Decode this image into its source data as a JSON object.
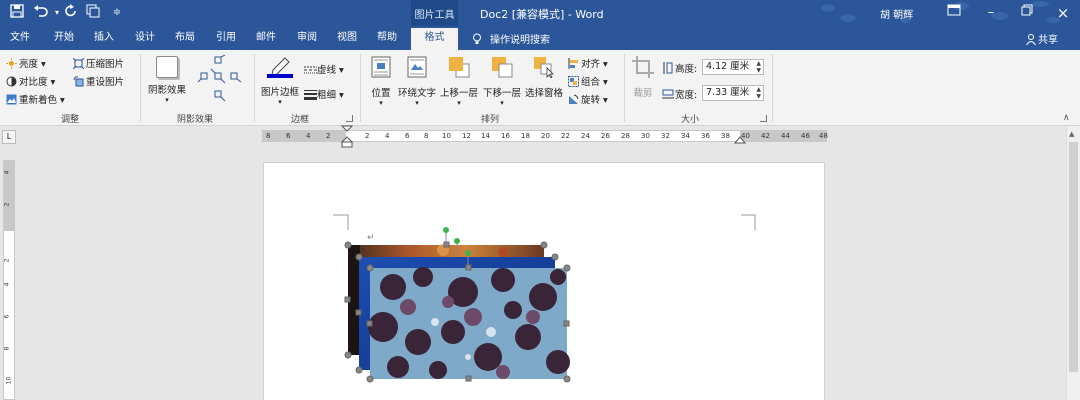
{
  "titlebar": {
    "context_tool": "图片工具",
    "doc_title": "Doc2 [兼容模式]  -  Word",
    "user": "胡 朝辉",
    "icons": [
      "save-icon",
      "undo-icon",
      "redo-icon",
      "touch-mode-icon",
      "customize-icon",
      "ribbon-display-icon",
      "minimize-icon",
      "restore-icon",
      "close-icon"
    ]
  },
  "tabs": [
    "文件",
    "开始",
    "插入",
    "设计",
    "布局",
    "引用",
    "邮件",
    "审阅",
    "视图",
    "帮助",
    "格式"
  ],
  "active_tab": "格式",
  "tell_me": "操作说明搜索",
  "share": "共享",
  "groups": {
    "adjust": {
      "label": "调整",
      "brightness": "亮度",
      "contrast": "对比度",
      "recolor": "重新着色",
      "compress": "压缩图片",
      "reset": "重设图片"
    },
    "shadow": {
      "label": "阴影效果",
      "button": "阴影效果"
    },
    "border": {
      "label": "边框",
      "button": "图片边框",
      "dashes": "虚线",
      "weight": "粗细"
    },
    "arrange": {
      "label": "排列",
      "position": "位置",
      "wrap": "环绕文字",
      "forward": "上移一层",
      "backward": "下移一层",
      "selection_pane": "选择窗格",
      "align": "对齐",
      "group": "组合",
      "rotate": "旋转"
    },
    "size": {
      "label": "大小",
      "crop": "裁剪",
      "height_label": "高度:",
      "height_value": "4.12 厘米",
      "width_label": "宽度:",
      "width_value": "7.33 厘米"
    }
  },
  "ruler": {
    "h_left": [
      "8",
      "6",
      "4",
      "2"
    ],
    "h_right": [
      "2",
      "4",
      "6",
      "8",
      "10",
      "12",
      "14",
      "16",
      "18",
      "20",
      "22",
      "24",
      "26",
      "28",
      "30",
      "32",
      "34",
      "36",
      "38",
      "40",
      "42",
      "44",
      "46",
      "48"
    ],
    "v": [
      "4",
      "2",
      "2",
      "4",
      "6",
      "8",
      "10"
    ],
    "corner": "L"
  },
  "colors": {
    "brand": "#2b579a",
    "handle_green": "#3cb44a"
  }
}
